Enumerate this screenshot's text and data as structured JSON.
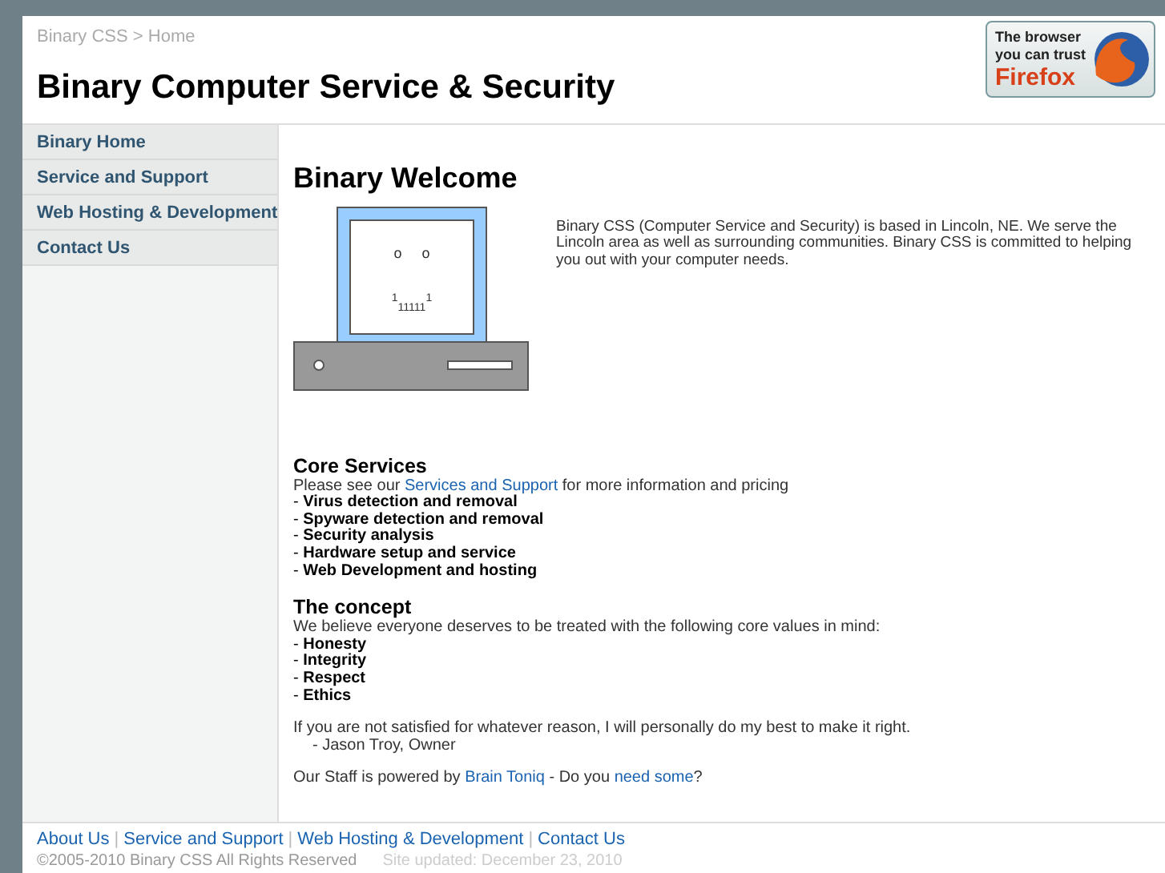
{
  "breadcrumb": "Binary CSS > Home",
  "site_title": "Binary Computer Service & Security",
  "badge": {
    "line_1": "The browser",
    "line_2": "you can trust",
    "line_3": "Firefox"
  },
  "sidebar": {
    "items": [
      {
        "label": "Binary Home"
      },
      {
        "label": "Service and Support"
      },
      {
        "label": "Web Hosting & Development"
      },
      {
        "label": "Contact Us"
      }
    ]
  },
  "main": {
    "heading": "Binary Welcome",
    "computer_face": {
      "eyes": "o     o",
      "mouth_top": "1         1",
      "mouth": "11111"
    },
    "intro": "Binary CSS (Computer Service and Security) is based in Lincoln, NE. We serve the Lincoln area as well as surrounding communities. Binary CSS is committed to helping you out with your computer needs.",
    "sections": [
      {
        "heading": "Core Services",
        "lead": [
          {
            "text": "Please see our ",
            "kind": "text"
          },
          {
            "text": "Services and Support",
            "kind": "link"
          },
          {
            "text": " for more information and pricing",
            "kind": "text"
          }
        ],
        "items": [
          "- **Virus detection and removal**",
          "- **Spyware detection and removal**",
          "- **Security analysis**",
          "- **Hardware setup and service**",
          "- **Web Development and hosting**"
        ]
      },
      {
        "heading": "The concept",
        "lead": [
          {
            "text": "We believe everyone deserves to be treated with the following core values in mind:",
            "kind": "text"
          }
        ],
        "items": [
          "- **Honesty**",
          "- **Integrity**",
          "- **Respect**",
          "- **Ethics**"
        ]
      }
    ],
    "closing": "If you are not satisfied for whatever reason, I will personally do my best to make it right.",
    "signature": "- Jason Troy, Owner",
    "powered": [
      {
        "text": "Our Staff is powered by ",
        "kind": "text"
      },
      {
        "text": "Brain Toniq",
        "kind": "link"
      },
      {
        "text": " - Do you ",
        "kind": "text"
      },
      {
        "text": "need some",
        "kind": "link"
      },
      {
        "text": "?",
        "kind": "text"
      }
    ]
  },
  "footer": {
    "links": [
      "About Us",
      "Service and Support",
      "Web Hosting & Development",
      "Contact Us"
    ],
    "separator": "|",
    "copyright": "©2005-2010 Binary CSS All Rights Reserved",
    "updated": "Site updated: December 23, 2010"
  }
}
